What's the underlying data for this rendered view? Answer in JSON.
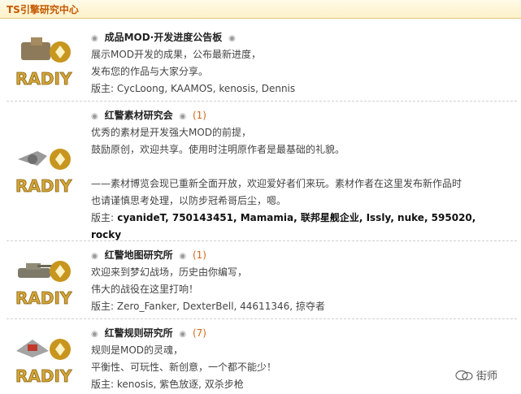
{
  "header": {
    "title": "TS引擎研究中心"
  },
  "forums": [
    {
      "title": "成品MOD·开发进度公告板",
      "count": "",
      "lines": [
        "展示MOD开发的成果，公布最新进度，",
        "发布您的作品与大家分享。"
      ],
      "moderators_label": "版主:",
      "moderators": " CycLoong, KAAMOS, kenosis, Dennis",
      "logo_text": "RADIY"
    },
    {
      "title": "红警素材研究会",
      "count": "(1)",
      "lines": [
        "优秀的素材是开发强大MOD的前提，",
        "鼓励原创，欢迎共享。使用时注明原作者是最基础的礼貌。",
        "",
        "——素材博览会现已重新全面开放，欢迎爱好者们来玩。素材作者在这里发布新作品时",
        "也请谨慎思考处理，以防步冠希哥后尘，嗯。"
      ],
      "moderators_label": "版主:",
      "moderators": " cyanideT, 750143451, Mamamia, 联邦星舰企业, Issly, nuke, 595020,",
      "moderators_line2": "rocky",
      "logo_text": "RADIY"
    },
    {
      "title": "红警地图研究所",
      "count": "(1)",
      "lines": [
        "欢迎来到梦幻战场，历史由你编写，",
        "伟大的战役在这里打响！"
      ],
      "moderators_label": "版主:",
      "moderators": " Zero_Fanker, DexterBell, 44611346, 掠夺者",
      "logo_text": "RADIY"
    },
    {
      "title": "红警规则研究所",
      "count": "(7)",
      "lines": [
        "规则是MOD的灵魂，",
        "平衡性、可玩性、新创意，一个都不能少！"
      ],
      "moderators_label": "版主:",
      "moderators": " kenosis, 紫色放逐, 双杀步枪",
      "logo_text": "RADIY"
    }
  ],
  "watermark": {
    "text": "街师",
    "icon": "wechat-icon"
  },
  "colors": {
    "header_text": "#c45800",
    "count": "#d2691e",
    "logo": "#c8961e"
  }
}
